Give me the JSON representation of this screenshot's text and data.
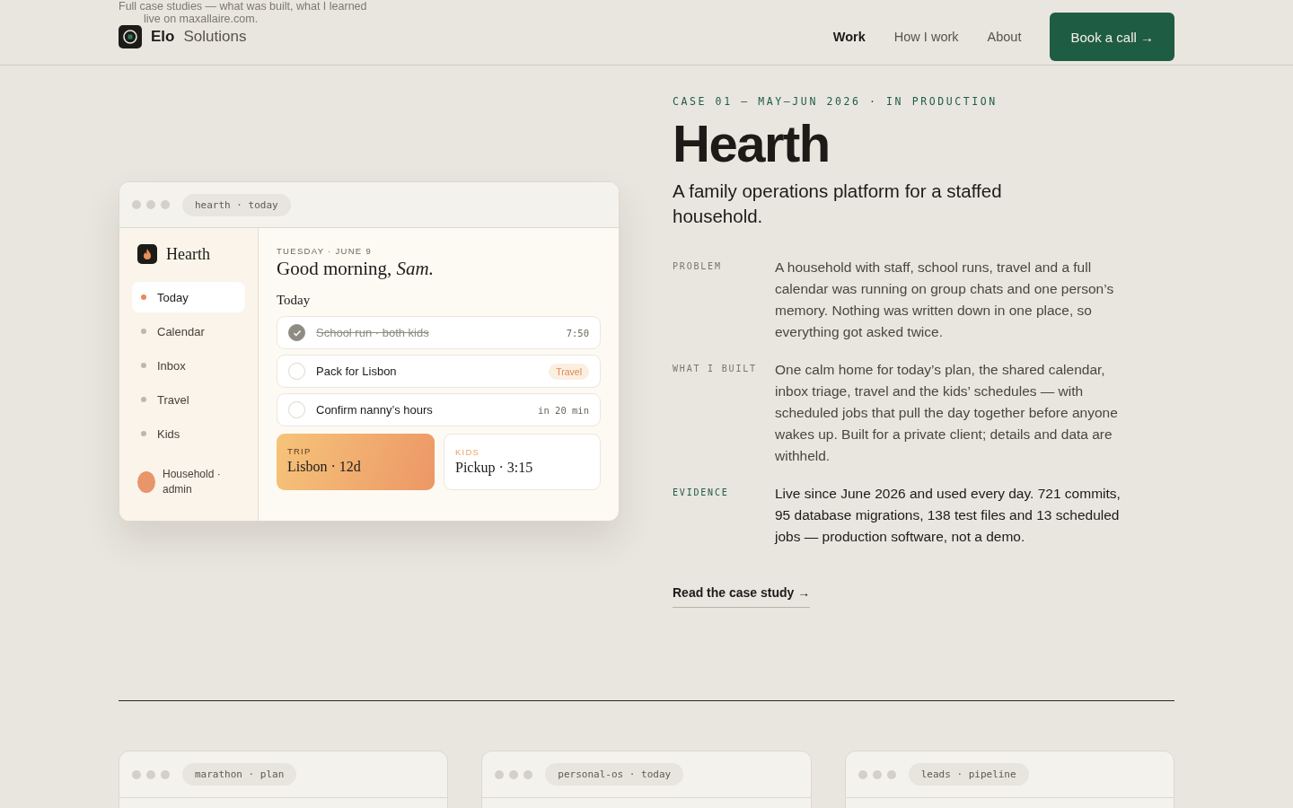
{
  "backdrop_text": [
    "Full case studies — what was built, what I learned",
    "live on maxallaire.com."
  ],
  "header": {
    "brand": {
      "name": "Elo",
      "suffix": "Solutions"
    },
    "nav": [
      {
        "label": "Work",
        "selected": true
      },
      {
        "label": "How I work",
        "selected": false
      },
      {
        "label": "About",
        "selected": false
      }
    ],
    "cta": "Book a call →"
  },
  "mockup": {
    "address": "hearth · today",
    "app_name": "Hearth",
    "sidebar": [
      {
        "label": "Today",
        "selected": true
      },
      {
        "label": "Calendar",
        "selected": false
      },
      {
        "label": "Inbox",
        "selected": false
      },
      {
        "label": "Travel",
        "selected": false
      },
      {
        "label": "Kids",
        "selected": false
      }
    ],
    "user": "Household · admin",
    "date": "TUESDAY · JUNE 9",
    "greeting": "Good morning, *Sam.*",
    "section": "Today",
    "tasks": [
      {
        "label": "School run · both kids",
        "done": true,
        "kind": "time",
        "meta": "7:50"
      },
      {
        "label": "Pack for Lisbon",
        "done": false,
        "kind": "tag",
        "meta": "Travel"
      },
      {
        "label": "Confirm nanny’s hours",
        "done": false,
        "kind": "time",
        "meta": "in 20 min"
      }
    ],
    "cards": [
      {
        "kind": "highlight",
        "label": "TRIP",
        "value": "Lisbon · 12d"
      },
      {
        "kind": "plain",
        "label": "KIDS",
        "value": "Pickup · 3:15"
      }
    ]
  },
  "case": {
    "eyebrow": "CASE 01 — MAY–JUN 2026 · IN PRODUCTION",
    "title": "Hearth",
    "subtitle": "A family operations platform for a staffed household.",
    "facts": [
      {
        "label": "PROBLEM",
        "kind": "muted",
        "text": "A household with staff, school runs, travel and a full calendar was running on group chats and one person’s memory. Nothing was written down in one place, so everything got asked twice."
      },
      {
        "label": "WHAT I BUILT",
        "kind": "muted",
        "text": "One calm home for today’s plan, the shared calendar, inbox triage, travel and the kids’ schedules — with scheduled jobs that pull the day together before anyone wakes up. Built for a private client; details and data are withheld."
      },
      {
        "label": "EVIDENCE",
        "kind": "strong",
        "text": "Live since June 2026 and used every day. 721 commits, 95 database migrations, 138 test files and 13 scheduled jobs — production software, not a demo."
      }
    ],
    "link": "Read the case study →"
  },
  "more_cases": [
    {
      "address": "marathon · plan"
    },
    {
      "address": "personal-os · today"
    },
    {
      "address": "leads · pipeline"
    }
  ]
}
